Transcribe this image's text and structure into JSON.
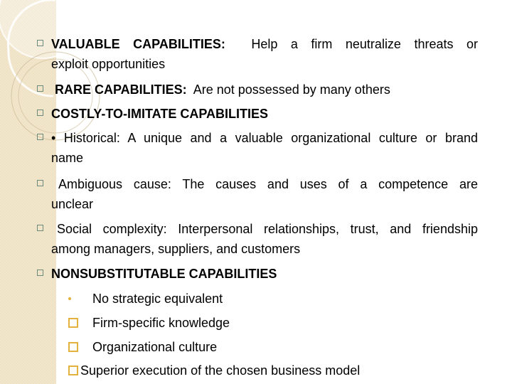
{
  "slide": {
    "colors": {
      "band": "#efe2c3",
      "main_bullet": "#6a8a7c",
      "sub_bullet": "#e3b23c",
      "text": "#000000"
    },
    "items": [
      {
        "bullet": "square-outline",
        "bold": "VALUABLE  CAPABILITIES:",
        "line1_rest": "Help a firm neutralize threats or",
        "line2": "exploit opportunities"
      },
      {
        "bullet": "square-outline",
        "bold": "RARE CAPABILITIES:",
        "rest": "Are not possessed by many others"
      },
      {
        "bullet": "square-outline",
        "bold": "COSTLY-TO-IMITATE CAPABILITIES"
      },
      {
        "bullet": "square-outline",
        "line1": "• Historical: A unique and a valuable organizational culture or brand",
        "line2": "name"
      },
      {
        "bullet": "square-outline",
        "line1": "Ambiguous cause: The causes and uses of a competence are",
        "line2": "unclear"
      },
      {
        "bullet": "square-outline",
        "line1": "Social complexity: Interpersonal relationships, trust, and friendship",
        "line2": "among managers, suppliers, and customers"
      },
      {
        "bullet": "square-outline",
        "bold": "NONSUBSTITUTABLE CAPABILITIES"
      }
    ],
    "sub_items": [
      {
        "bullet": "dot",
        "text": "No strategic equivalent"
      },
      {
        "bullet": "square-outline-gold",
        "text": "Firm-specific knowledge"
      },
      {
        "bullet": "square-outline-gold",
        "text": "Organizational culture"
      },
      {
        "bullet": "square-outline-gold",
        "text": "Superior execution of the chosen business model"
      }
    ]
  }
}
